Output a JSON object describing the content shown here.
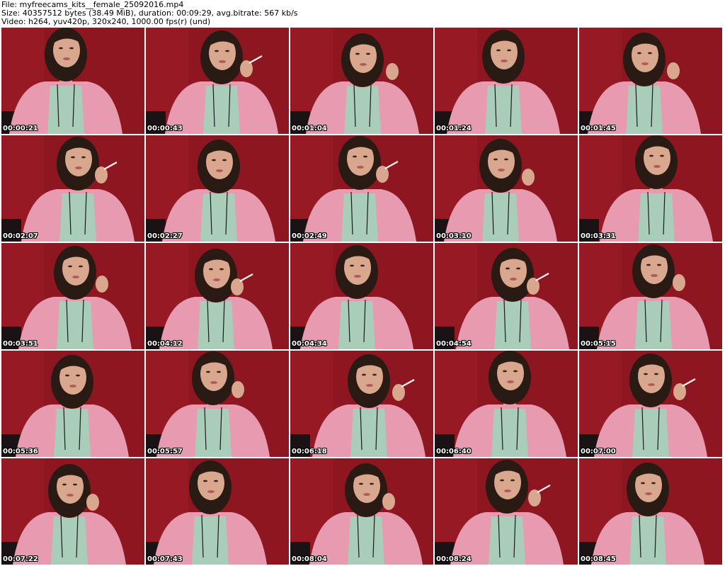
{
  "header": {
    "file_line": "File: myfreecams_kits__female_25092016.mp4",
    "size_line": "Size: 40357512 bytes (38.49 MiB), duration: 00:09:29, avg.bitrate: 567 kb/s",
    "video_line": "Video: h264, yuv420p, 320x240, 1000.00 fps(r) (und)"
  },
  "thumbnails": [
    {
      "time": "00:00:21"
    },
    {
      "time": "00:00:43"
    },
    {
      "time": "00:01:04"
    },
    {
      "time": "00:01:24"
    },
    {
      "time": "00:01:45"
    },
    {
      "time": "00:02:07"
    },
    {
      "time": "00:02:27"
    },
    {
      "time": "00:02:49"
    },
    {
      "time": "00:03:10"
    },
    {
      "time": "00:03:31"
    },
    {
      "time": "00:03:51"
    },
    {
      "time": "00:04:12"
    },
    {
      "time": "00:04:34"
    },
    {
      "time": "00:04:54"
    },
    {
      "time": "00:05:15"
    },
    {
      "time": "00:05:36"
    },
    {
      "time": "00:05:57"
    },
    {
      "time": "00:06:18"
    },
    {
      "time": "00:06:40"
    },
    {
      "time": "00:07:00"
    },
    {
      "time": "00:07:22"
    },
    {
      "time": "00:07:43"
    },
    {
      "time": "00:08:04"
    },
    {
      "time": "00:08:24"
    },
    {
      "time": "00:08:45"
    }
  ],
  "colors": {
    "background_wall": "#8e1620",
    "sweater": "#e89bb0",
    "inner_top": "#a9cdb8",
    "hair": "#2a1a14",
    "skin": "#d9a78e",
    "timestamp_text": "#ffffff"
  }
}
